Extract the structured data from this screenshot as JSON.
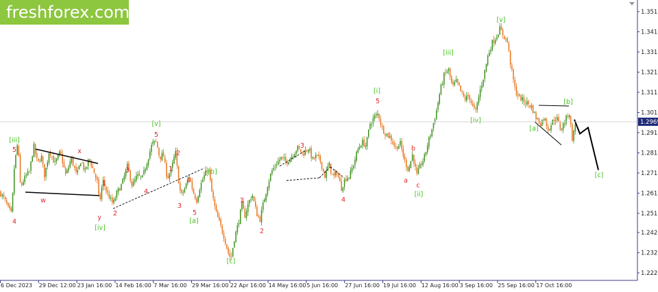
{
  "brand": {
    "logo_text": "freshforex.com",
    "brand_color": "#8dc63f"
  },
  "chart_data": {
    "type": "candlestick",
    "title": "",
    "xlabel": "",
    "ylabel": "",
    "ylim": [
      1.217,
      1.356
    ],
    "grid": false,
    "current_price": "1.2969",
    "y_ticks": [
      "1.3515",
      "1.3415",
      "1.3315",
      "1.3215",
      "1.3115",
      "1.3015",
      "1.2915",
      "1.2815",
      "1.2715",
      "1.2615",
      "1.2515",
      "1.2420",
      "1.2320",
      "1.2220"
    ],
    "x_ticks": [
      "6 Dec 2023",
      "29 Dec 12:00",
      "23 Jan 16:00",
      "14 Feb 16:00",
      "7 Mar 16:00",
      "29 Mar 16:00",
      "22 Apr 16:00",
      "14 May 16:00",
      "5 Jun 16:00",
      "27 Jun 16:00",
      "19 Jul 16:00",
      "12 Aug 16:00",
      "3 Sep 16:00",
      "25 Sep 16:00",
      "17 Oct 16:00"
    ],
    "colors": {
      "up": "#3a8f1a",
      "down": "#e8731a",
      "wave_red": "#e0262a",
      "wave_green": "#43c21f",
      "axis": "#3a3a8a",
      "label_bg": "#1e2a78"
    },
    "price_path": [
      [
        0,
        1.262
      ],
      [
        7,
        1.258
      ],
      [
        12,
        1.254
      ],
      [
        17,
        1.251
      ],
      [
        21,
        1.275
      ],
      [
        26,
        1.287
      ],
      [
        30,
        1.264
      ],
      [
        33,
        1.267
      ],
      [
        38,
        1.27
      ],
      [
        43,
        1.272
      ],
      [
        49,
        1.285
      ],
      [
        55,
        1.276
      ],
      [
        60,
        1.28
      ],
      [
        65,
        1.27
      ],
      [
        72,
        1.283
      ],
      [
        80,
        1.276
      ],
      [
        88,
        1.282
      ],
      [
        96,
        1.27
      ],
      [
        104,
        1.279
      ],
      [
        112,
        1.27
      ],
      [
        118,
        1.278
      ],
      [
        124,
        1.272
      ],
      [
        130,
        1.279
      ],
      [
        138,
        1.271
      ],
      [
        142,
        1.267
      ],
      [
        145,
        1.256
      ],
      [
        150,
        1.268
      ],
      [
        157,
        1.261
      ],
      [
        165,
        1.256
      ],
      [
        171,
        1.262
      ],
      [
        178,
        1.266
      ],
      [
        186,
        1.275
      ],
      [
        193,
        1.265
      ],
      [
        200,
        1.27
      ],
      [
        208,
        1.269
      ],
      [
        216,
        1.279
      ],
      [
        222,
        1.286
      ],
      [
        228,
        1.287
      ],
      [
        233,
        1.279
      ],
      [
        238,
        1.281
      ],
      [
        244,
        1.269
      ],
      [
        250,
        1.273
      ],
      [
        256,
        1.282
      ],
      [
        260,
        1.269
      ],
      [
        264,
        1.26
      ],
      [
        270,
        1.264
      ],
      [
        276,
        1.27
      ],
      [
        282,
        1.262
      ],
      [
        287,
        1.258
      ],
      [
        292,
        1.265
      ],
      [
        298,
        1.27
      ],
      [
        304,
        1.274
      ],
      [
        309,
        1.262
      ],
      [
        315,
        1.252
      ],
      [
        321,
        1.246
      ],
      [
        327,
        1.24
      ],
      [
        333,
        1.232
      ],
      [
        337,
        1.229
      ],
      [
        342,
        1.239
      ],
      [
        348,
        1.247
      ],
      [
        353,
        1.256
      ],
      [
        357,
        1.25
      ],
      [
        362,
        1.256
      ],
      [
        368,
        1.261
      ],
      [
        374,
        1.252
      ],
      [
        379,
        1.248
      ],
      [
        384,
        1.256
      ],
      [
        390,
        1.265
      ],
      [
        396,
        1.272
      ],
      [
        403,
        1.276
      ],
      [
        410,
        1.279
      ],
      [
        418,
        1.277
      ],
      [
        426,
        1.28
      ],
      [
        434,
        1.284
      ],
      [
        442,
        1.281
      ],
      [
        450,
        1.284
      ],
      [
        456,
        1.278
      ],
      [
        462,
        1.28
      ],
      [
        468,
        1.277
      ],
      [
        474,
        1.27
      ],
      [
        480,
        1.276
      ],
      [
        486,
        1.269
      ],
      [
        492,
        1.272
      ],
      [
        498,
        1.264
      ],
      [
        504,
        1.269
      ],
      [
        510,
        1.27
      ],
      [
        516,
        1.276
      ],
      [
        522,
        1.283
      ],
      [
        528,
        1.287
      ],
      [
        534,
        1.285
      ],
      [
        540,
        1.296
      ],
      [
        546,
        1.299
      ],
      [
        552,
        1.301
      ],
      [
        557,
        1.294
      ],
      [
        563,
        1.291
      ],
      [
        570,
        1.289
      ],
      [
        577,
        1.284
      ],
      [
        584,
        1.286
      ],
      [
        590,
        1.278
      ],
      [
        596,
        1.273
      ],
      [
        602,
        1.281
      ],
      [
        608,
        1.27
      ],
      [
        613,
        1.275
      ],
      [
        619,
        1.279
      ],
      [
        624,
        1.286
      ],
      [
        630,
        1.293
      ],
      [
        636,
        1.301
      ],
      [
        642,
        1.312
      ],
      [
        648,
        1.32
      ],
      [
        654,
        1.323
      ],
      [
        660,
        1.314
      ],
      [
        666,
        1.317
      ],
      [
        672,
        1.312
      ],
      [
        678,
        1.308
      ],
      [
        684,
        1.31
      ],
      [
        690,
        1.304
      ],
      [
        694,
        1.302
      ],
      [
        700,
        1.312
      ],
      [
        706,
        1.32
      ],
      [
        712,
        1.33
      ],
      [
        718,
        1.336
      ],
      [
        724,
        1.339
      ],
      [
        729,
        1.343
      ],
      [
        734,
        1.34
      ],
      [
        740,
        1.337
      ],
      [
        746,
        1.323
      ],
      [
        752,
        1.312
      ],
      [
        758,
        1.309
      ],
      [
        764,
        1.307
      ],
      [
        770,
        1.306
      ],
      [
        776,
        1.304
      ],
      [
        782,
        1.299
      ],
      [
        788,
        1.296
      ],
      [
        794,
        1.299
      ],
      [
        800,
        1.293
      ],
      [
        806,
        1.297
      ],
      [
        812,
        1.299
      ],
      [
        818,
        1.293
      ],
      [
        824,
        1.297
      ],
      [
        830,
        1.302
      ],
      [
        835,
        1.288
      ],
      [
        840,
        1.2969
      ]
    ],
    "forecast_path": [
      [
        838,
        1.298
      ],
      [
        846,
        1.291
      ],
      [
        858,
        1.294
      ],
      [
        873,
        1.273
      ]
    ],
    "wave_labels": [
      {
        "text": "[iii]",
        "x": 21,
        "y": 208,
        "color": "green"
      },
      {
        "text": "5",
        "x": 21,
        "y": 222,
        "color": "red"
      },
      {
        "text": "4",
        "x": 21,
        "y": 327,
        "color": "red"
      },
      {
        "text": "w",
        "x": 63,
        "y": 296,
        "color": "red"
      },
      {
        "text": "x",
        "x": 116,
        "y": 224,
        "color": "red"
      },
      {
        "text": "1",
        "x": 152,
        "y": 271,
        "color": "red"
      },
      {
        "text": "y",
        "x": 145,
        "y": 321,
        "color": "red"
      },
      {
        "text": "[iv]",
        "x": 146,
        "y": 336,
        "color": "green"
      },
      {
        "text": "2",
        "x": 168,
        "y": 315,
        "color": "red"
      },
      {
        "text": "3",
        "x": 186,
        "y": 252,
        "color": "red"
      },
      {
        "text": "4",
        "x": 213,
        "y": 283,
        "color": "red"
      },
      {
        "text": "[v]",
        "x": 228,
        "y": 184,
        "color": "green"
      },
      {
        "text": "5",
        "x": 228,
        "y": 200,
        "color": "red"
      },
      {
        "text": "1",
        "x": 249,
        "y": 250,
        "color": "red"
      },
      {
        "text": "2",
        "x": 260,
        "y": 227,
        "color": "red"
      },
      {
        "text": "4",
        "x": 275,
        "y": 267,
        "color": "red"
      },
      {
        "text": "3",
        "x": 262,
        "y": 304,
        "color": "red"
      },
      {
        "text": "5",
        "x": 284,
        "y": 314,
        "color": "red"
      },
      {
        "text": "[a]",
        "x": 283,
        "y": 326,
        "color": "green"
      },
      {
        "text": "[b]",
        "x": 310,
        "y": 254,
        "color": "green"
      },
      {
        "text": "1",
        "x": 353,
        "y": 296,
        "color": "red"
      },
      {
        "text": "2",
        "x": 382,
        "y": 341,
        "color": "red"
      },
      {
        "text": "[c]",
        "x": 337,
        "y": 385,
        "color": "green"
      },
      {
        "text": "3",
        "x": 441,
        "y": 216,
        "color": "red"
      },
      {
        "text": "4",
        "x": 501,
        "y": 295,
        "color": "red"
      },
      {
        "text": "[i]",
        "x": 550,
        "y": 136,
        "color": "green"
      },
      {
        "text": "5",
        "x": 551,
        "y": 151,
        "color": "red"
      },
      {
        "text": "b",
        "x": 603,
        "y": 220,
        "color": "red"
      },
      {
        "text": "a",
        "x": 592,
        "y": 267,
        "color": "red"
      },
      {
        "text": "c",
        "x": 610,
        "y": 274,
        "color": "red"
      },
      {
        "text": "[ii]",
        "x": 611,
        "y": 287,
        "color": "green"
      },
      {
        "text": "[iii]",
        "x": 654,
        "y": 80,
        "color": "green"
      },
      {
        "text": "[iv]",
        "x": 694,
        "y": 179,
        "color": "green"
      },
      {
        "text": "[v]",
        "x": 731,
        "y": 32,
        "color": "green"
      },
      {
        "text": "[a]",
        "x": 779,
        "y": 191,
        "color": "green"
      },
      {
        "text": "[b]",
        "x": 829,
        "y": 152,
        "color": "green"
      },
      {
        "text": "[c]",
        "x": 874,
        "y": 259,
        "color": "green"
      }
    ]
  }
}
